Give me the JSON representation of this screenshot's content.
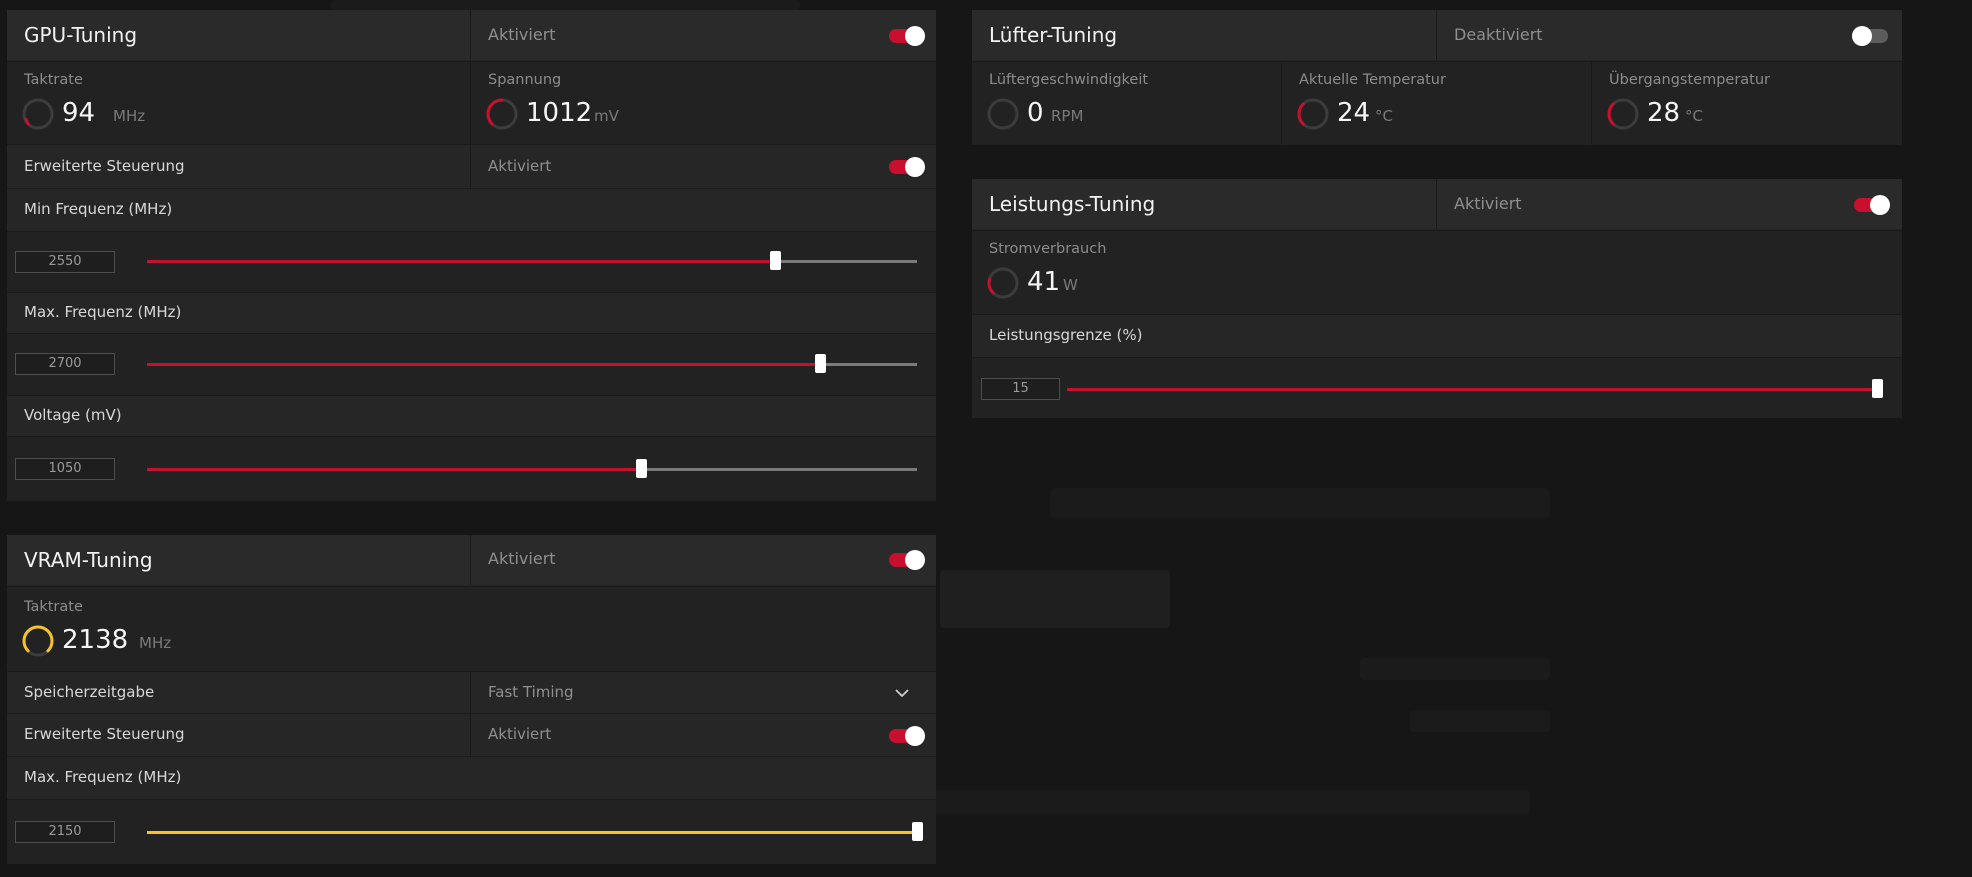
{
  "colors": {
    "accent_red": "#c8102e",
    "accent_yellow": "#f2c230",
    "toggle_off": "#5c5c5c"
  },
  "gpu_tuning": {
    "title": "GPU-Tuning",
    "status": "Aktiviert",
    "enabled": true,
    "clock": {
      "label": "Taktrate",
      "value": "94",
      "unit": "MHz"
    },
    "voltage": {
      "label": "Spannung",
      "value": "1012",
      "unit": "mV"
    },
    "advanced": {
      "label": "Erweiterte Steuerung",
      "status": "Aktiviert",
      "enabled": true
    },
    "sliders": [
      {
        "label": "Min Frequenz (MHz)",
        "value": "2550",
        "fraction": 0.815
      },
      {
        "label": "Max. Frequenz (MHz)",
        "value": "2700",
        "fraction": 0.874
      },
      {
        "label": "Voltage (mV)",
        "value": "1050",
        "fraction": 0.642
      }
    ]
  },
  "vram_tuning": {
    "title": "VRAM-Tuning",
    "status": "Aktiviert",
    "enabled": true,
    "clock": {
      "label": "Taktrate",
      "value": "2138",
      "unit": "MHz"
    },
    "memory_timing": {
      "label": "Speicherzeitgabe",
      "value": "Fast Timing"
    },
    "advanced": {
      "label": "Erweiterte Steuerung",
      "status": "Aktiviert",
      "enabled": true
    },
    "slider": {
      "label": "Max. Frequenz (MHz)",
      "value": "2150",
      "fraction": 1.0
    }
  },
  "fan_tuning": {
    "title": "Lüfter-Tuning",
    "status": "Deaktiviert",
    "enabled": false,
    "fan_speed": {
      "label": "Lüftergeschwindigkeit",
      "value": "0",
      "unit": "RPM"
    },
    "current_temp": {
      "label": "Aktuelle Temperatur",
      "value": "24",
      "unit": "°C"
    },
    "junction_temp": {
      "label": "Übergangstemperatur",
      "value": "28",
      "unit": "°C"
    }
  },
  "power_tuning": {
    "title": "Leistungs-Tuning",
    "status": "Aktiviert",
    "enabled": true,
    "power_draw": {
      "label": "Stromverbrauch",
      "value": "41",
      "unit": "W"
    },
    "slider": {
      "label": "Leistungsgrenze (%)",
      "value": "15",
      "fraction": 1.0
    }
  }
}
